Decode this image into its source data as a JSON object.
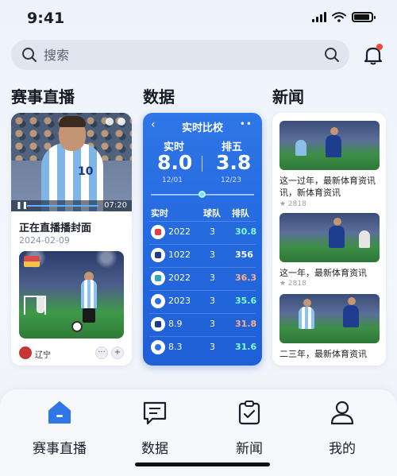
{
  "status": {
    "time": "9:41"
  },
  "search": {
    "placeholder": "搜索"
  },
  "sections": {
    "live": "赛事直播",
    "data": "数据",
    "news": "新闻"
  },
  "live_card": {
    "duration": "07:20",
    "jersey_number": "10",
    "title": "正在直播播封面",
    "date": "2024-02-09",
    "team_name": "辽宁",
    "more": "···",
    "add": "+"
  },
  "data_card": {
    "back": "‹",
    "title": "实时比校",
    "more": "••",
    "left_label": "实时",
    "left_score": "8.0",
    "left_date": "12/01",
    "right_label": "排五",
    "right_score": "3.8",
    "right_date": "12/23",
    "headers": [
      "实时",
      "球队",
      "排队"
    ],
    "rows": [
      {
        "icon": "ic-red",
        "c1": "2022",
        "c2": "3",
        "c3": "30.8",
        "color": "#7fffd2"
      },
      {
        "icon": "ic-navy",
        "c1": "1022",
        "c2": "3",
        "c3": "356",
        "color": "#ffffff"
      },
      {
        "icon": "ic-teal",
        "c1": "2022",
        "c2": "3",
        "c3": "36.3",
        "color": "#ffb08a"
      },
      {
        "icon": "ic-blue",
        "c1": "2023",
        "c2": "3",
        "c3": "35.6",
        "color": "#7fffd2"
      },
      {
        "icon": "ic-navy",
        "c1": "8.9",
        "c2": "3",
        "c3": "31.8",
        "color": "#ffb08a"
      },
      {
        "icon": "ic-blue",
        "c1": "8.3",
        "c2": "3",
        "c3": "31.6",
        "color": "#7fffd2"
      }
    ]
  },
  "news": [
    {
      "title": "这一过年，最新体育资讯讯，新体育资讯",
      "meta": "★ 2818"
    },
    {
      "title": "这一年，最新体育资讯",
      "meta": "★ 2818"
    },
    {
      "title": "二三年，最新体育资讯",
      "meta": ""
    }
  ],
  "nav": [
    {
      "label": "赛事直播",
      "active": true
    },
    {
      "label": "数据",
      "active": false
    },
    {
      "label": "新闻",
      "active": false
    },
    {
      "label": "我的",
      "active": false
    }
  ],
  "colors": {
    "accent": "#2f76e8",
    "notify": "#f2473b"
  }
}
